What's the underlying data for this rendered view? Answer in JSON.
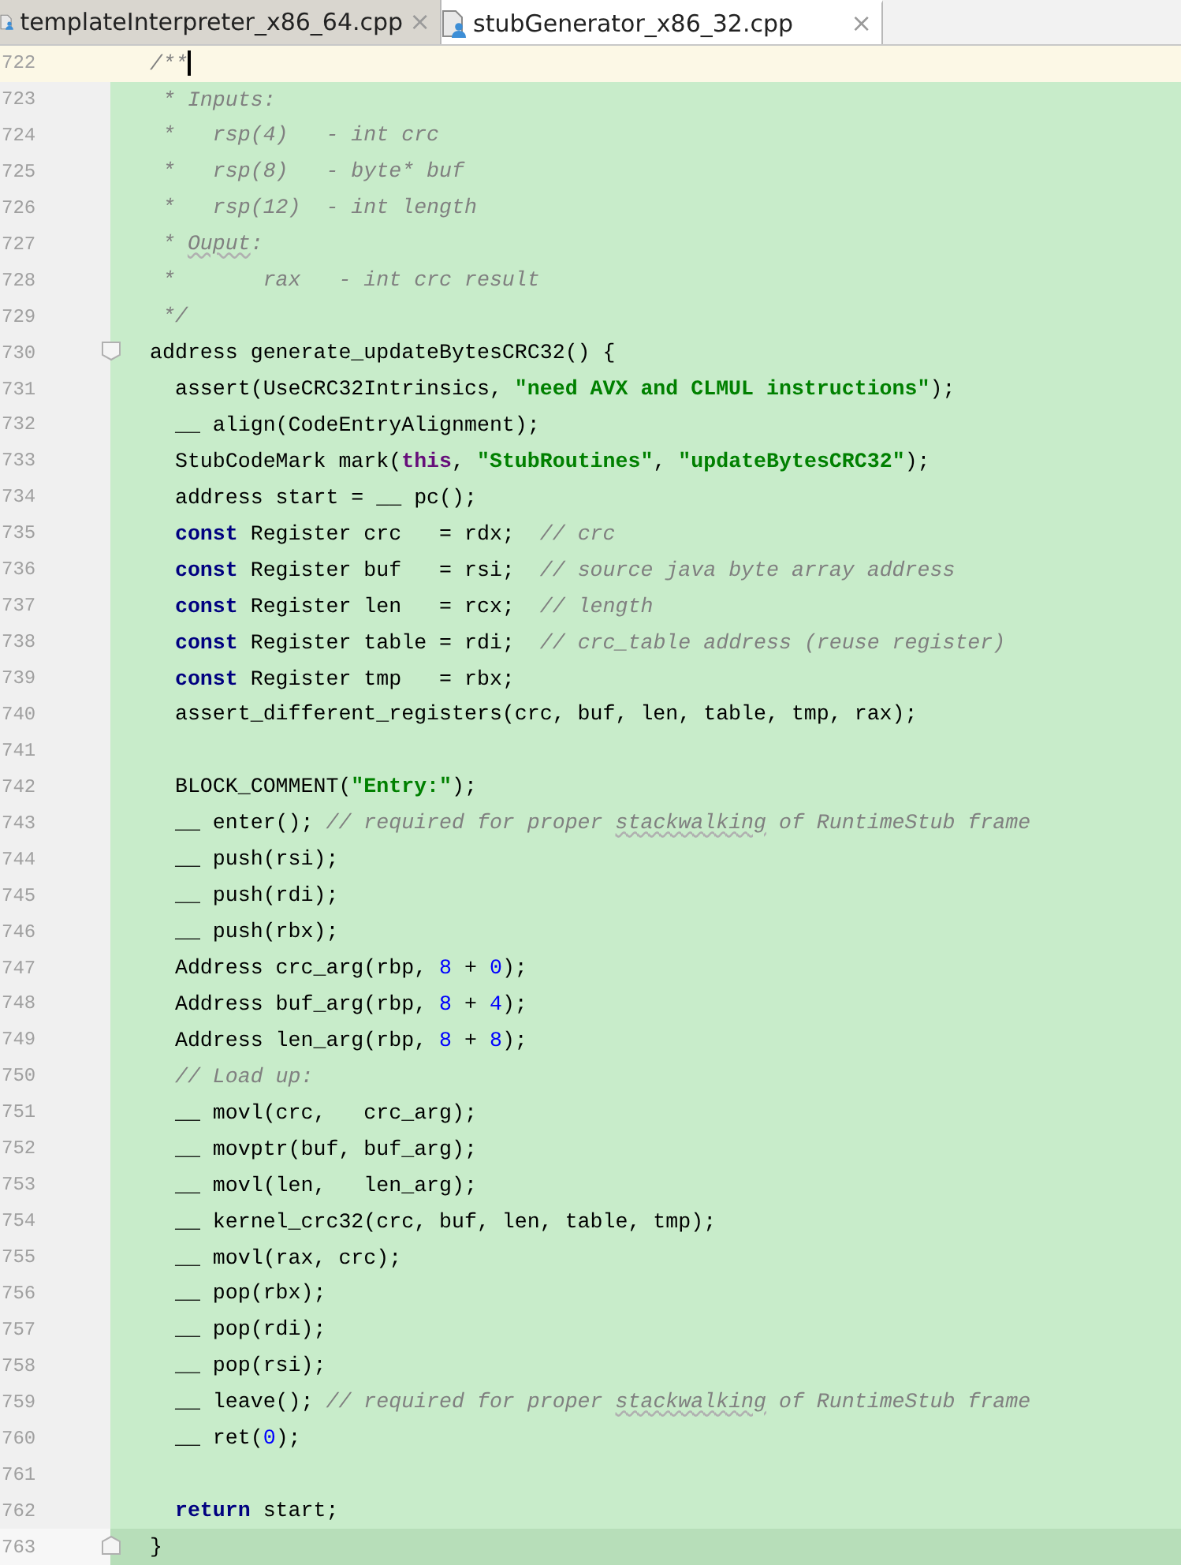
{
  "tabs": [
    {
      "label": "templateInterpreter_x86_64.cpp",
      "selected": false,
      "close": "×"
    },
    {
      "label": "stubGenerator_x86_32.cpp",
      "selected": true,
      "close": "×"
    }
  ],
  "lines": [
    {
      "number": "722",
      "kind": "current",
      "tokens": [
        {
          "kind": "comment",
          "text": "/**"
        }
      ]
    },
    {
      "number": "723",
      "kind": "changed",
      "tokens": [
        {
          "kind": "comment",
          "text": " * Inputs:"
        }
      ]
    },
    {
      "number": "724",
      "kind": "changed",
      "tokens": [
        {
          "kind": "comment",
          "text": " *   rsp(4)   - int crc"
        }
      ]
    },
    {
      "number": "725",
      "kind": "changed",
      "tokens": [
        {
          "kind": "comment",
          "text": " *   rsp(8)   - byte* buf"
        }
      ]
    },
    {
      "number": "726",
      "kind": "changed",
      "tokens": [
        {
          "kind": "comment",
          "text": " *   rsp(12)  - int length"
        }
      ]
    },
    {
      "number": "727",
      "kind": "changed",
      "tokens": [
        {
          "kind": "comment",
          "text": " * "
        },
        {
          "kind": "typo",
          "text": "Ouput"
        },
        {
          "kind": "comment",
          "text": ":"
        }
      ]
    },
    {
      "number": "728",
      "kind": "changed",
      "tokens": [
        {
          "kind": "comment",
          "text": " *       rax   - int crc result"
        }
      ]
    },
    {
      "number": "729",
      "kind": "changed",
      "tokens": [
        {
          "kind": "comment",
          "text": " */"
        }
      ]
    },
    {
      "number": "730",
      "kind": "fold_start",
      "tokens": [
        {
          "kind": "plain",
          "text": "address generate_updateBytesCRC32() {"
        }
      ]
    },
    {
      "number": "731",
      "kind": "changed",
      "tokens": [
        {
          "kind": "plain",
          "text": "  assert(UseCRC32Intrinsics, "
        },
        {
          "kind": "string",
          "text": "\"need AVX and CLMUL instructions\""
        },
        {
          "kind": "plain",
          "text": ");"
        }
      ]
    },
    {
      "number": "732",
      "kind": "changed",
      "tokens": [
        {
          "kind": "plain",
          "text": "  __ align(CodeEntryAlignment);"
        }
      ]
    },
    {
      "number": "733",
      "kind": "changed",
      "tokens": [
        {
          "kind": "plain",
          "text": "  StubCodeMark mark("
        },
        {
          "kind": "this",
          "text": "this"
        },
        {
          "kind": "plain",
          "text": ", "
        },
        {
          "kind": "string",
          "text": "\"StubRoutines\""
        },
        {
          "kind": "plain",
          "text": ", "
        },
        {
          "kind": "string",
          "text": "\"updateBytesCRC32\""
        },
        {
          "kind": "plain",
          "text": ");"
        }
      ]
    },
    {
      "number": "734",
      "kind": "changed",
      "tokens": [
        {
          "kind": "plain",
          "text": "  address start = __ pc();"
        }
      ]
    },
    {
      "number": "735",
      "kind": "changed",
      "tokens": [
        {
          "kind": "keyword",
          "text": "  const"
        },
        {
          "kind": "plain",
          "text": " Register crc   = rdx;  "
        },
        {
          "kind": "comment",
          "text": "// crc"
        }
      ]
    },
    {
      "number": "736",
      "kind": "changed",
      "tokens": [
        {
          "kind": "keyword",
          "text": "  const"
        },
        {
          "kind": "plain",
          "text": " Register buf   = rsi;  "
        },
        {
          "kind": "comment",
          "text": "// source java byte array address"
        }
      ]
    },
    {
      "number": "737",
      "kind": "changed",
      "tokens": [
        {
          "kind": "keyword",
          "text": "  const"
        },
        {
          "kind": "plain",
          "text": " Register len   = rcx;  "
        },
        {
          "kind": "comment",
          "text": "// length"
        }
      ]
    },
    {
      "number": "738",
      "kind": "changed",
      "tokens": [
        {
          "kind": "keyword",
          "text": "  const"
        },
        {
          "kind": "plain",
          "text": " Register table = rdi;  "
        },
        {
          "kind": "comment",
          "text": "// crc_table address (reuse register)"
        }
      ]
    },
    {
      "number": "739",
      "kind": "changed",
      "tokens": [
        {
          "kind": "keyword",
          "text": "  const"
        },
        {
          "kind": "plain",
          "text": " Register tmp   = rbx;"
        }
      ]
    },
    {
      "number": "740",
      "kind": "changed",
      "tokens": [
        {
          "kind": "plain",
          "text": "  assert_different_registers(crc, buf, len, table, tmp, rax);"
        }
      ]
    },
    {
      "number": "741",
      "kind": "changed"
    },
    {
      "number": "742",
      "kind": "changed",
      "tokens": [
        {
          "kind": "plain",
          "text": "  BLOCK_COMMENT("
        },
        {
          "kind": "string",
          "text": "\"Entry:\""
        },
        {
          "kind": "plain",
          "text": ");"
        }
      ]
    },
    {
      "number": "743",
      "kind": "changed",
      "tokens": [
        {
          "kind": "plain",
          "text": "  __ enter(); "
        },
        {
          "kind": "comment",
          "text": "// required for proper "
        },
        {
          "kind": "typo",
          "text": "stackwalking"
        },
        {
          "kind": "comment",
          "text": " of RuntimeStub frame"
        }
      ]
    },
    {
      "number": "744",
      "kind": "changed",
      "tokens": [
        {
          "kind": "plain",
          "text": "  __ push(rsi);"
        }
      ]
    },
    {
      "number": "745",
      "kind": "changed",
      "tokens": [
        {
          "kind": "plain",
          "text": "  __ push(rdi);"
        }
      ]
    },
    {
      "number": "746",
      "kind": "changed",
      "tokens": [
        {
          "kind": "plain",
          "text": "  __ push(rbx);"
        }
      ]
    },
    {
      "number": "747",
      "kind": "changed",
      "tokens": [
        {
          "kind": "plain",
          "text": "  Address crc_arg(rbp, "
        },
        {
          "kind": "number",
          "text": "8"
        },
        {
          "kind": "plain",
          "text": " + "
        },
        {
          "kind": "number",
          "text": "0"
        },
        {
          "kind": "plain",
          "text": ");"
        }
      ]
    },
    {
      "number": "748",
      "kind": "changed",
      "tokens": [
        {
          "kind": "plain",
          "text": "  Address buf_arg(rbp, "
        },
        {
          "kind": "number",
          "text": "8"
        },
        {
          "kind": "plain",
          "text": " + "
        },
        {
          "kind": "number",
          "text": "4"
        },
        {
          "kind": "plain",
          "text": ");"
        }
      ]
    },
    {
      "number": "749",
      "kind": "changed",
      "tokens": [
        {
          "kind": "plain",
          "text": "  Address len_arg(rbp, "
        },
        {
          "kind": "number",
          "text": "8"
        },
        {
          "kind": "plain",
          "text": " + "
        },
        {
          "kind": "number",
          "text": "8"
        },
        {
          "kind": "plain",
          "text": ");"
        }
      ]
    },
    {
      "number": "750",
      "kind": "changed",
      "tokens": [
        {
          "kind": "comment",
          "text": "  // Load up:"
        }
      ]
    },
    {
      "number": "751",
      "kind": "changed",
      "tokens": [
        {
          "kind": "plain",
          "text": "  __ movl(crc,   crc_arg);"
        }
      ]
    },
    {
      "number": "752",
      "kind": "changed",
      "tokens": [
        {
          "kind": "plain",
          "text": "  __ movptr(buf, buf_arg);"
        }
      ]
    },
    {
      "number": "753",
      "kind": "changed",
      "tokens": [
        {
          "kind": "plain",
          "text": "  __ movl(len,   len_arg);"
        }
      ]
    },
    {
      "number": "754",
      "kind": "changed",
      "tokens": [
        {
          "kind": "plain",
          "text": "  __ kernel_crc32(crc, buf, len, table, tmp);"
        }
      ]
    },
    {
      "number": "755",
      "kind": "changed",
      "tokens": [
        {
          "kind": "plain",
          "text": "  __ movl(rax, crc);"
        }
      ]
    },
    {
      "number": "756",
      "kind": "changed",
      "tokens": [
        {
          "kind": "plain",
          "text": "  __ pop(rbx);"
        }
      ]
    },
    {
      "number": "757",
      "kind": "changed",
      "tokens": [
        {
          "kind": "plain",
          "text": "  __ pop(rdi);"
        }
      ]
    },
    {
      "number": "758",
      "kind": "changed",
      "tokens": [
        {
          "kind": "plain",
          "text": "  __ pop(rsi);"
        }
      ]
    },
    {
      "number": "759",
      "kind": "changed",
      "tokens": [
        {
          "kind": "plain",
          "text": "  __ leave(); "
        },
        {
          "kind": "comment",
          "text": "// required for proper "
        },
        {
          "kind": "typo",
          "text": "stackwalking"
        },
        {
          "kind": "comment",
          "text": " of RuntimeStub frame"
        }
      ]
    },
    {
      "number": "760",
      "kind": "changed",
      "tokens": [
        {
          "kind": "plain",
          "text": "  __ ret("
        },
        {
          "kind": "number",
          "text": "0"
        },
        {
          "kind": "plain",
          "text": ");"
        }
      ]
    },
    {
      "number": "761",
      "kind": "changed"
    },
    {
      "number": "762",
      "kind": "changed",
      "tokens": [
        {
          "kind": "keyword",
          "text": "  return"
        },
        {
          "kind": "plain",
          "text": " start;"
        }
      ]
    },
    {
      "number": "763",
      "kind": "fold_end",
      "tokens": [
        {
          "kind": "plain",
          "text": "}"
        }
      ]
    }
  ]
}
